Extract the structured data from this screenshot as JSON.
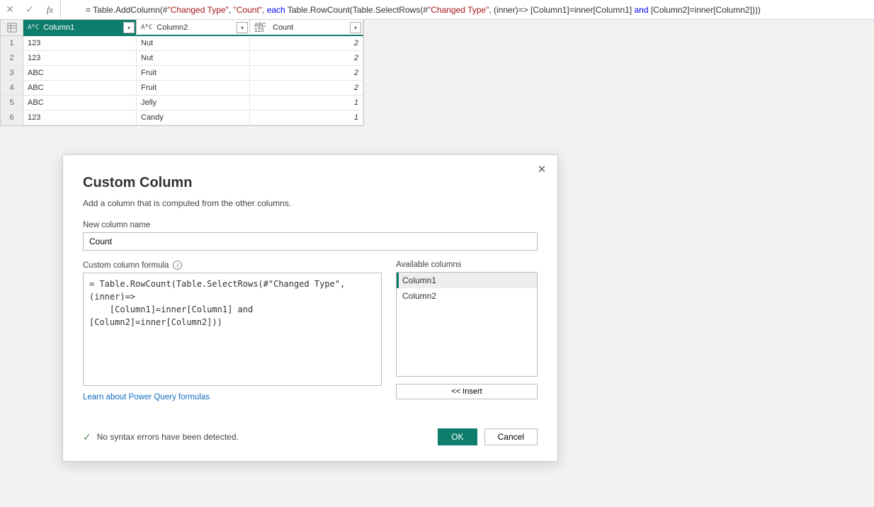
{
  "formula_bar": {
    "fx_label": "fx",
    "tokens": {
      "eq": "= ",
      "fn1": "Table.AddColumn",
      "op1": "(#",
      "str1": "\"Changed Type\"",
      "op2": ", ",
      "str2": "\"Count\"",
      "op3": ", ",
      "kw1": "each",
      "sp1": " ",
      "fn2": "Table.RowCount",
      "op4": "(",
      "fn3": "Table.SelectRows",
      "op5": "(#",
      "str3": "\"Changed Type\"",
      "op6": ", (inner)=> [Column1]=inner[Column1] ",
      "kw2": "and",
      "op7": " [Column2]=inner[Column2])))"
    }
  },
  "grid": {
    "columns": [
      {
        "type_icon": "AᴮC",
        "name": "Column1",
        "style": "selected"
      },
      {
        "type_icon": "AᴮC",
        "name": "Column2",
        "style": "light"
      },
      {
        "type_icon": "ABC123",
        "name": "Count",
        "style": "light"
      }
    ],
    "rows": [
      {
        "n": "1",
        "c1": "123",
        "c2": "Nut",
        "c3": "2"
      },
      {
        "n": "2",
        "c1": "123",
        "c2": "Nut",
        "c3": "2"
      },
      {
        "n": "3",
        "c1": "ABC",
        "c2": "Fruit",
        "c3": "2"
      },
      {
        "n": "4",
        "c1": "ABC",
        "c2": "Fruit",
        "c3": "2"
      },
      {
        "n": "5",
        "c1": "ABC",
        "c2": "Jelly",
        "c3": "1"
      },
      {
        "n": "6",
        "c1": "123",
        "c2": "Candy",
        "c3": "1"
      }
    ]
  },
  "dialog": {
    "title": "Custom Column",
    "subtitle": "Add a column that is computed from the other columns.",
    "new_name_label": "New column name",
    "new_name_value": "Count",
    "formula_label": "Custom column formula",
    "formula_text": "= Table.RowCount(Table.SelectRows(#\"Changed Type\", (inner)=>\n    [Column1]=inner[Column1] and [Column2]=inner[Column2]))",
    "available_label": "Available columns",
    "available": [
      "Column1",
      "Column2"
    ],
    "insert_label": "<< Insert",
    "learn_link": "Learn about Power Query formulas",
    "syntax_ok": "No syntax errors have been detected.",
    "ok_label": "OK",
    "cancel_label": "Cancel"
  }
}
